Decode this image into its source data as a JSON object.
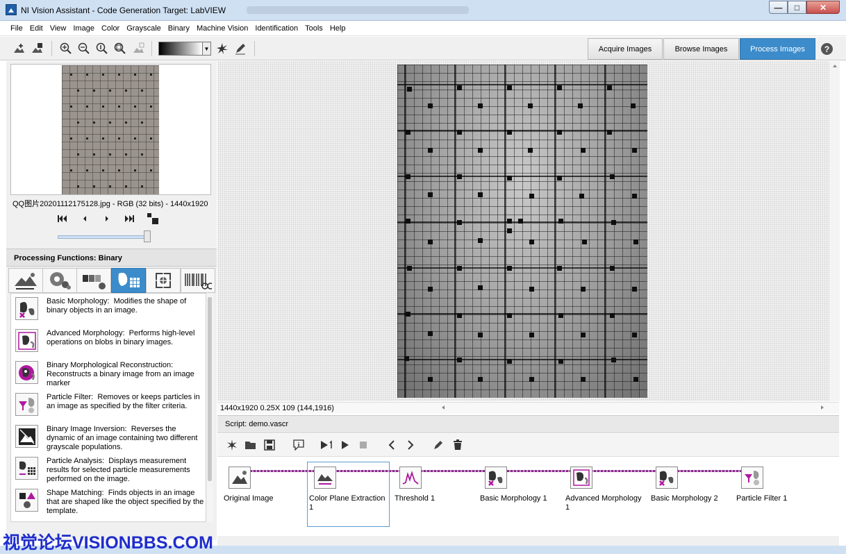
{
  "window": {
    "title": "NI Vision Assistant - Code Generation Target: LabVIEW",
    "min": "—",
    "max": "□",
    "close": "✕"
  },
  "menu": [
    "File",
    "Edit",
    "View",
    "Image",
    "Color",
    "Grayscale",
    "Binary",
    "Machine Vision",
    "Identification",
    "Tools",
    "Help"
  ],
  "tabs": {
    "acquire": "Acquire Images",
    "browse": "Browse Images",
    "process": "Process Images",
    "help": "?"
  },
  "thumbnail": {
    "caption": "QQ图片20201112175128.jpg - RGB (32 bits) - 1440x1920",
    "nav_first": "⏮",
    "nav_prev": "◂",
    "nav_next": "▸",
    "nav_last": "⏭"
  },
  "processing": {
    "title": "Processing Functions: Binary",
    "functions": [
      {
        "name": "Basic Morphology:",
        "desc": "Modifies the shape of binary objects in an image."
      },
      {
        "name": "Advanced Morphology:",
        "desc": "Performs high-level operations on blobs in binary images."
      },
      {
        "name": "Binary Morphological Reconstruction:",
        "desc": "Reconstructs a binary image from an image marker"
      },
      {
        "name": "Particle Filter:",
        "desc": "Removes or keeps particles in an image as specified by the filter criteria."
      },
      {
        "name": "Binary Image Inversion:",
        "desc": "Reverses the dynamic of an image containing two different grayscale populations."
      },
      {
        "name": "Particle Analysis:",
        "desc": "Displays measurement results for selected particle measurements performed on the image."
      },
      {
        "name": "Shape Matching:",
        "desc": "Finds objects in an image that are shaped like the object specified by the template."
      }
    ]
  },
  "status": {
    "text": "1440x1920 0.25X 109   (144,1916)"
  },
  "script": {
    "title": "Script: demo.vascr",
    "steps": [
      {
        "label": "Original Image"
      },
      {
        "label": "Color Plane Extraction 1"
      },
      {
        "label": "Threshold 1"
      },
      {
        "label": "Basic Morphology 1"
      },
      {
        "label": "Advanced Morphology 1"
      },
      {
        "label": "Basic Morphology 2"
      },
      {
        "label": "Particle Filter 1"
      }
    ]
  },
  "watermark": "视觉论坛VISIONBBS.COM"
}
